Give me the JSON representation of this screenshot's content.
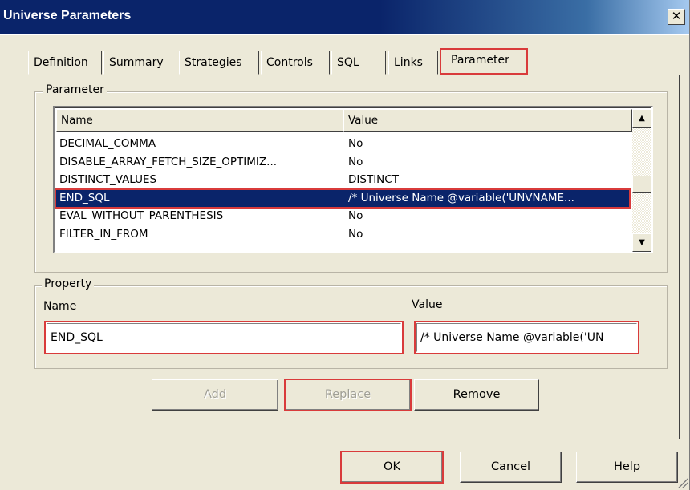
{
  "window": {
    "title": "Universe Parameters",
    "close_glyph": "✕"
  },
  "tabs": [
    {
      "label": "Definition"
    },
    {
      "label": "Summary"
    },
    {
      "label": "Strategies"
    },
    {
      "label": "Controls"
    },
    {
      "label": "SQL"
    },
    {
      "label": "Links"
    },
    {
      "label": "Parameter"
    }
  ],
  "active_tab": "Parameter",
  "parameter_group": {
    "title": "Parameter",
    "columns": {
      "name": "Name",
      "value": "Value"
    },
    "rows": [
      {
        "name": "DECIMAL_COMMA",
        "value": "No"
      },
      {
        "name": "DISABLE_ARRAY_FETCH_SIZE_OPTIMIZ...",
        "value": "No"
      },
      {
        "name": "DISTINCT_VALUES",
        "value": "DISTINCT"
      },
      {
        "name": "END_SQL",
        "value": "/* Universe Name @variable('UNVNAME..."
      },
      {
        "name": "EVAL_WITHOUT_PARENTHESIS",
        "value": "No"
      },
      {
        "name": "FILTER_IN_FROM",
        "value": "No"
      }
    ],
    "selected_row": "END_SQL",
    "scroll_up_glyph": "▲",
    "scroll_down_glyph": "▼"
  },
  "property_group": {
    "title": "Property",
    "name_label": "Name",
    "value_label": "Value",
    "name_value": "END_SQL",
    "value_value": "/* Universe Name @variable('UN"
  },
  "buttons": {
    "add": "Add",
    "replace": "Replace",
    "remove": "Remove",
    "ok": "OK",
    "cancel": "Cancel",
    "help": "Help"
  },
  "colors": {
    "highlight_outline": "#d93b3b",
    "selection": "#0a246a",
    "dialog_face": "#ece9d8"
  }
}
